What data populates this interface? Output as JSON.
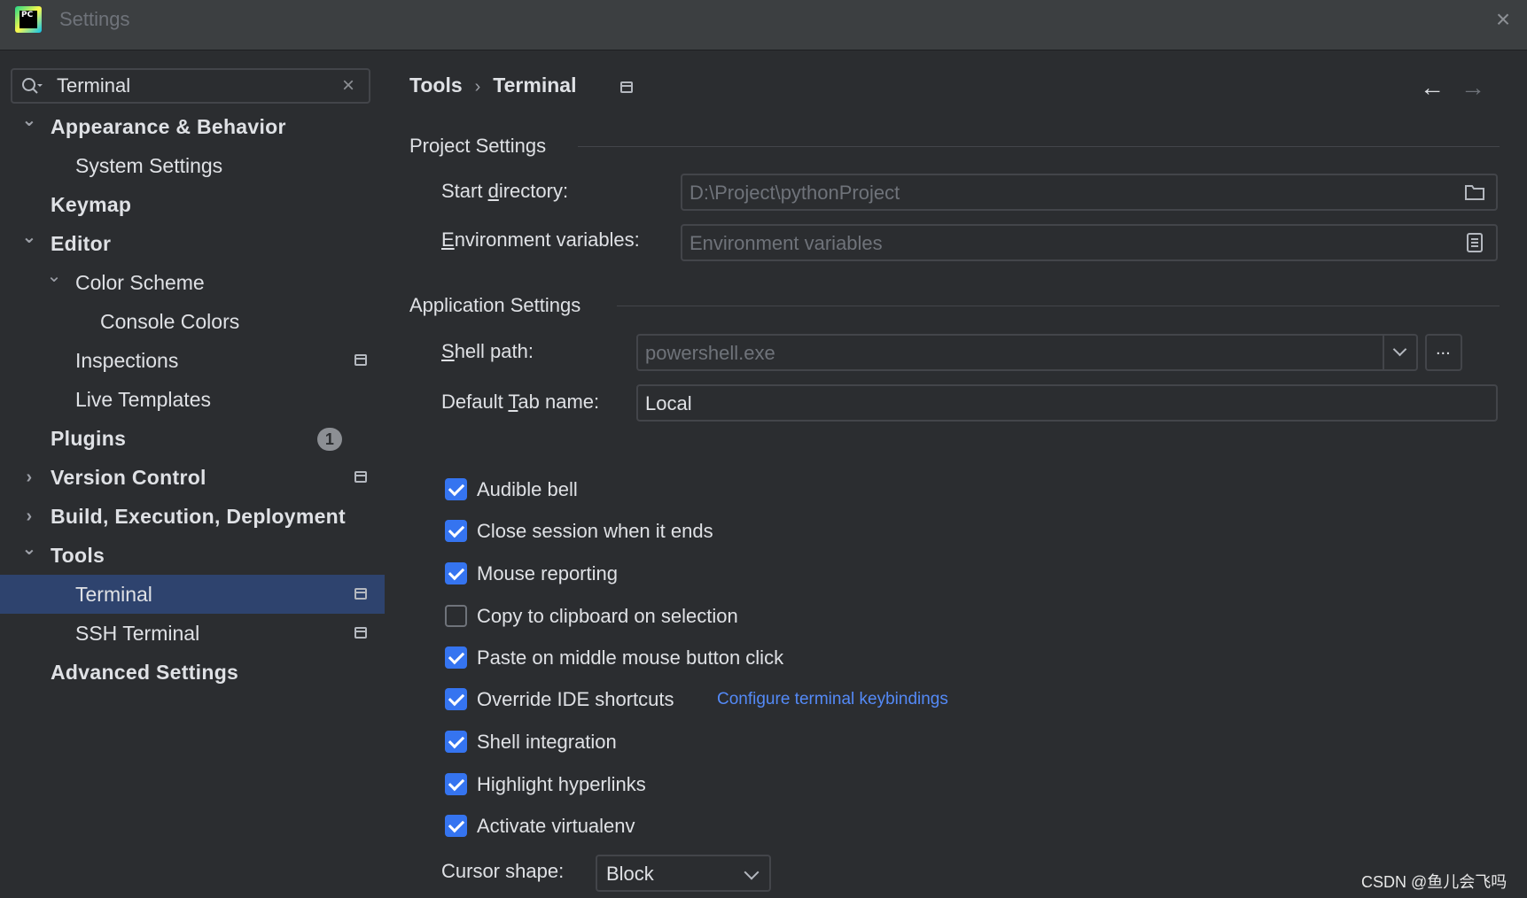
{
  "window": {
    "title": "Settings",
    "logo_text": "PC"
  },
  "search": {
    "value": "Terminal"
  },
  "tree": [
    {
      "label": "Appearance & Behavior",
      "bold": true,
      "level": 0,
      "chevron": "expanded"
    },
    {
      "label": "System Settings",
      "bold": false,
      "level": 1
    },
    {
      "label": "Keymap",
      "bold": true,
      "level": 0
    },
    {
      "label": "Editor",
      "bold": true,
      "level": 0,
      "chevron": "expanded"
    },
    {
      "label": "Color Scheme",
      "bold": false,
      "level": 1,
      "chevron": "expanded"
    },
    {
      "label": "Console Colors",
      "bold": false,
      "level": 2
    },
    {
      "label": "Inspections",
      "bold": false,
      "level": 1,
      "project_icon": true
    },
    {
      "label": "Live Templates",
      "bold": false,
      "level": 1
    },
    {
      "label": "Plugins",
      "bold": true,
      "level": 0,
      "badge": "1"
    },
    {
      "label": "Version Control",
      "bold": true,
      "level": 0,
      "chevron": "collapsed",
      "project_icon": true
    },
    {
      "label": "Build, Execution, Deployment",
      "bold": true,
      "level": 0,
      "chevron": "collapsed"
    },
    {
      "label": "Tools",
      "bold": true,
      "level": 0,
      "chevron": "expanded"
    },
    {
      "label": "Terminal",
      "bold": false,
      "level": 1,
      "selected": true,
      "project_icon": true
    },
    {
      "label": "SSH Terminal",
      "bold": false,
      "level": 1,
      "project_icon": true
    },
    {
      "label": "Advanced Settings",
      "bold": true,
      "level": 0
    }
  ],
  "breadcrumb": {
    "parent": "Tools",
    "separator": "›",
    "current": "Terminal"
  },
  "project_settings": {
    "title": "Project Settings",
    "start_directory": {
      "label_pre": "Start ",
      "label_mnemonic": "d",
      "label_post": "irectory:",
      "value": "D:\\Project\\pythonProject"
    },
    "env_vars": {
      "label_pre": "",
      "label_mnemonic": "E",
      "label_post": "nvironment variables:",
      "placeholder": "Environment variables"
    }
  },
  "application_settings": {
    "title": "Application Settings",
    "shell_path": {
      "label_pre": "",
      "label_mnemonic": "S",
      "label_post": "hell path:",
      "value": "powershell.exe",
      "browse_label": "..."
    },
    "default_tab": {
      "label_pre": "Default ",
      "label_mnemonic": "T",
      "label_post": "ab name:",
      "value": "Local"
    },
    "checkboxes": [
      {
        "label": "Audible bell",
        "checked": true
      },
      {
        "label": "Close session when it ends",
        "checked": true
      },
      {
        "label": "Mouse reporting",
        "checked": true
      },
      {
        "label": "Copy to clipboard on selection",
        "checked": false
      },
      {
        "label": "Paste on middle mouse button click",
        "checked": true
      },
      {
        "label": "Override IDE shortcuts",
        "checked": true,
        "link": "Configure terminal keybindings"
      },
      {
        "label": "Shell integration",
        "checked": true
      },
      {
        "label": "Highlight hyperlinks",
        "checked": true
      },
      {
        "label": "Activate virtualenv",
        "checked": true
      }
    ],
    "cursor_shape": {
      "label": "Cursor shape:",
      "value": "Block"
    }
  },
  "colors": {
    "accent": "#3574f0",
    "link": "#548af7",
    "selection": "#2e436e",
    "background": "#2b2d30"
  },
  "watermark": "CSDN @鱼儿会飞吗"
}
